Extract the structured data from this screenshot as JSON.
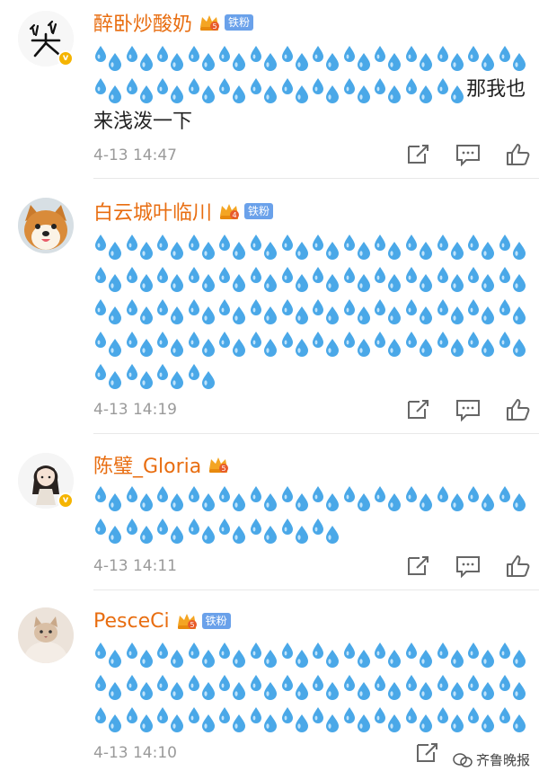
{
  "colors": {
    "username": "#e86d10",
    "drop": "#4aa8e8",
    "fan_badge": "#6aa1ea",
    "verified": "#f5b400"
  },
  "comments": [
    {
      "username": "醉卧炒酸奶",
      "crown_level": "5",
      "fan_badge": "铁粉",
      "verified": true,
      "avatar_icon": "calligraphy-xiao-icon",
      "emoji_count": 26,
      "trailing_text": "那我也来浅泼一下",
      "timestamp": "4-13 14:47"
    },
    {
      "username": "白云城叶临川",
      "crown_level": "4",
      "fan_badge": "铁粉",
      "verified": false,
      "avatar_icon": "shiba-dog-icon",
      "emoji_count": 60,
      "trailing_text": "",
      "timestamp": "4-13 14:19"
    },
    {
      "username": "陈璧_Gloria",
      "crown_level": "5",
      "fan_badge": "",
      "verified": true,
      "avatar_icon": "anime-girl-icon",
      "emoji_count": 22,
      "trailing_text": "",
      "timestamp": "4-13 14:11"
    },
    {
      "username": "PesceCi",
      "crown_level": "5",
      "fan_badge": "铁粉",
      "verified": false,
      "avatar_icon": "cat-blanket-icon",
      "emoji_count": 42,
      "trailing_text": "",
      "timestamp": "4-13 14:10"
    }
  ],
  "watermark": "齐鲁晚报"
}
